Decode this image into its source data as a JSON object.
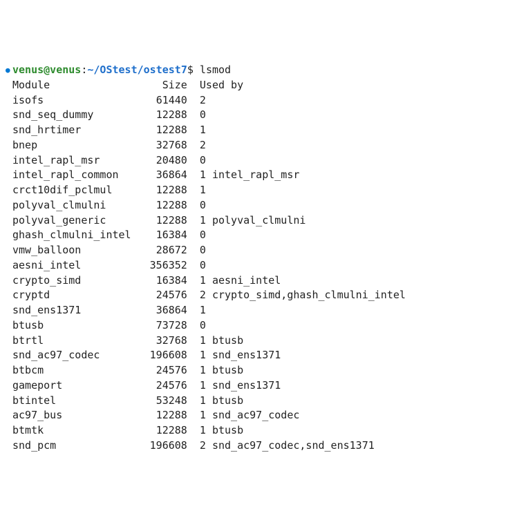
{
  "prompt": {
    "user": "venus@venus",
    "colon": ":",
    "path": "~/OStest/ostest7",
    "dollar": "$",
    "command": "lsmod"
  },
  "header": {
    "module": "Module",
    "size": "Size",
    "used_by": "Used by"
  },
  "rows": [
    {
      "module": "isofs",
      "size": "61440",
      "used": "2",
      "by": ""
    },
    {
      "module": "snd_seq_dummy",
      "size": "12288",
      "used": "0",
      "by": ""
    },
    {
      "module": "snd_hrtimer",
      "size": "12288",
      "used": "1",
      "by": ""
    },
    {
      "module": "bnep",
      "size": "32768",
      "used": "2",
      "by": ""
    },
    {
      "module": "intel_rapl_msr",
      "size": "20480",
      "used": "0",
      "by": ""
    },
    {
      "module": "intel_rapl_common",
      "size": "36864",
      "used": "1",
      "by": "intel_rapl_msr"
    },
    {
      "module": "crct10dif_pclmul",
      "size": "12288",
      "used": "1",
      "by": ""
    },
    {
      "module": "polyval_clmulni",
      "size": "12288",
      "used": "0",
      "by": ""
    },
    {
      "module": "polyval_generic",
      "size": "12288",
      "used": "1",
      "by": "polyval_clmulni"
    },
    {
      "module": "ghash_clmulni_intel",
      "size": "16384",
      "used": "0",
      "by": ""
    },
    {
      "module": "vmw_balloon",
      "size": "28672",
      "used": "0",
      "by": ""
    },
    {
      "module": "aesni_intel",
      "size": "356352",
      "used": "0",
      "by": ""
    },
    {
      "module": "crypto_simd",
      "size": "16384",
      "used": "1",
      "by": "aesni_intel"
    },
    {
      "module": "cryptd",
      "size": "24576",
      "used": "2",
      "by": "crypto_simd,ghash_clmulni_intel"
    },
    {
      "module": "snd_ens1371",
      "size": "36864",
      "used": "1",
      "by": ""
    },
    {
      "module": "btusb",
      "size": "73728",
      "used": "0",
      "by": ""
    },
    {
      "module": "btrtl",
      "size": "32768",
      "used": "1",
      "by": "btusb"
    },
    {
      "module": "snd_ac97_codec",
      "size": "196608",
      "used": "1",
      "by": "snd_ens1371"
    },
    {
      "module": "btbcm",
      "size": "24576",
      "used": "1",
      "by": "btusb"
    },
    {
      "module": "gameport",
      "size": "24576",
      "used": "1",
      "by": "snd_ens1371"
    },
    {
      "module": "btintel",
      "size": "53248",
      "used": "1",
      "by": "btusb"
    },
    {
      "module": "ac97_bus",
      "size": "12288",
      "used": "1",
      "by": "snd_ac97_codec"
    },
    {
      "module": "btmtk",
      "size": "12288",
      "used": "1",
      "by": "btusb"
    },
    {
      "module": "snd_pcm",
      "size": "196608",
      "used": "2",
      "by": "snd_ac97_codec,snd_ens1371"
    }
  ]
}
